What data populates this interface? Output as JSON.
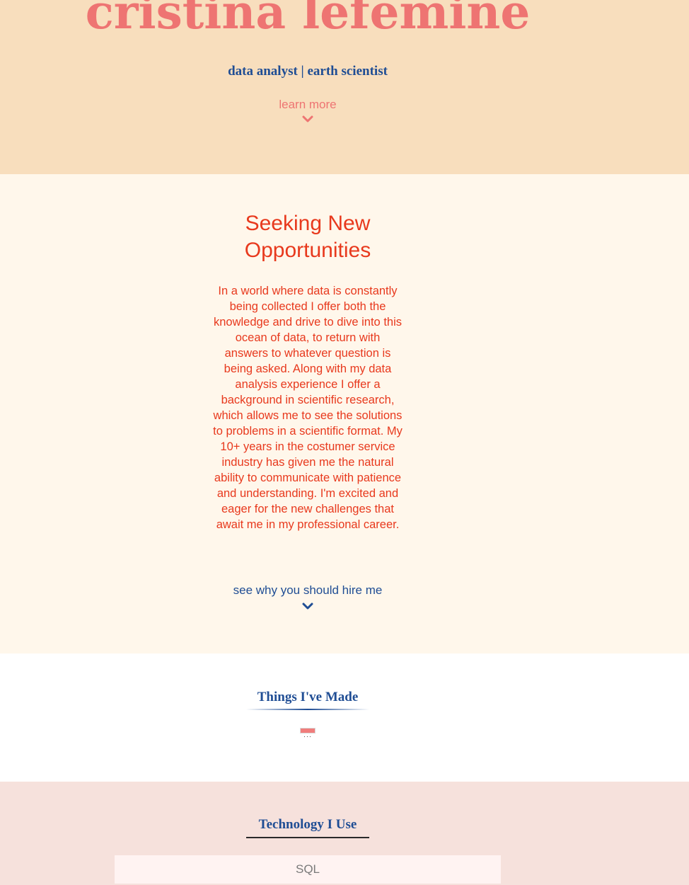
{
  "hero": {
    "name": "cristina lefemine",
    "subtitle": "data analyst | earth scientist",
    "learn_more": "learn more"
  },
  "about": {
    "title": "Seeking New Opportunities",
    "body": "In a world where data is constantly being collected I offer both the knowledge and drive to dive into this ocean of data, to return with answers to whatever question is being asked. Along with my data analysis experience I offer a background in scientific research, which allows me to see the solutions to problems in a scientific format. My 10+ years in the costumer service industry has given me the natural ability to communicate with patience and understanding. I'm excited and eager for the new challenges that await me in my professional career.",
    "hire_link": "see why you should hire me"
  },
  "projects": {
    "title": "Things I've Made"
  },
  "tech": {
    "title": "Technology I Use",
    "items": [
      "SQL"
    ]
  },
  "colors": {
    "hero_bg": "#f8debd",
    "coral": "#ee7472",
    "navy": "#1f4d94",
    "about_bg": "#fff7eb",
    "about_text": "#e8391d",
    "tech_bg": "#f6e1dc"
  },
  "icons": {
    "learn_more": "chevron-down-icon",
    "hire_link": "chevron-down-icon",
    "project_image": "broken-image-icon"
  }
}
